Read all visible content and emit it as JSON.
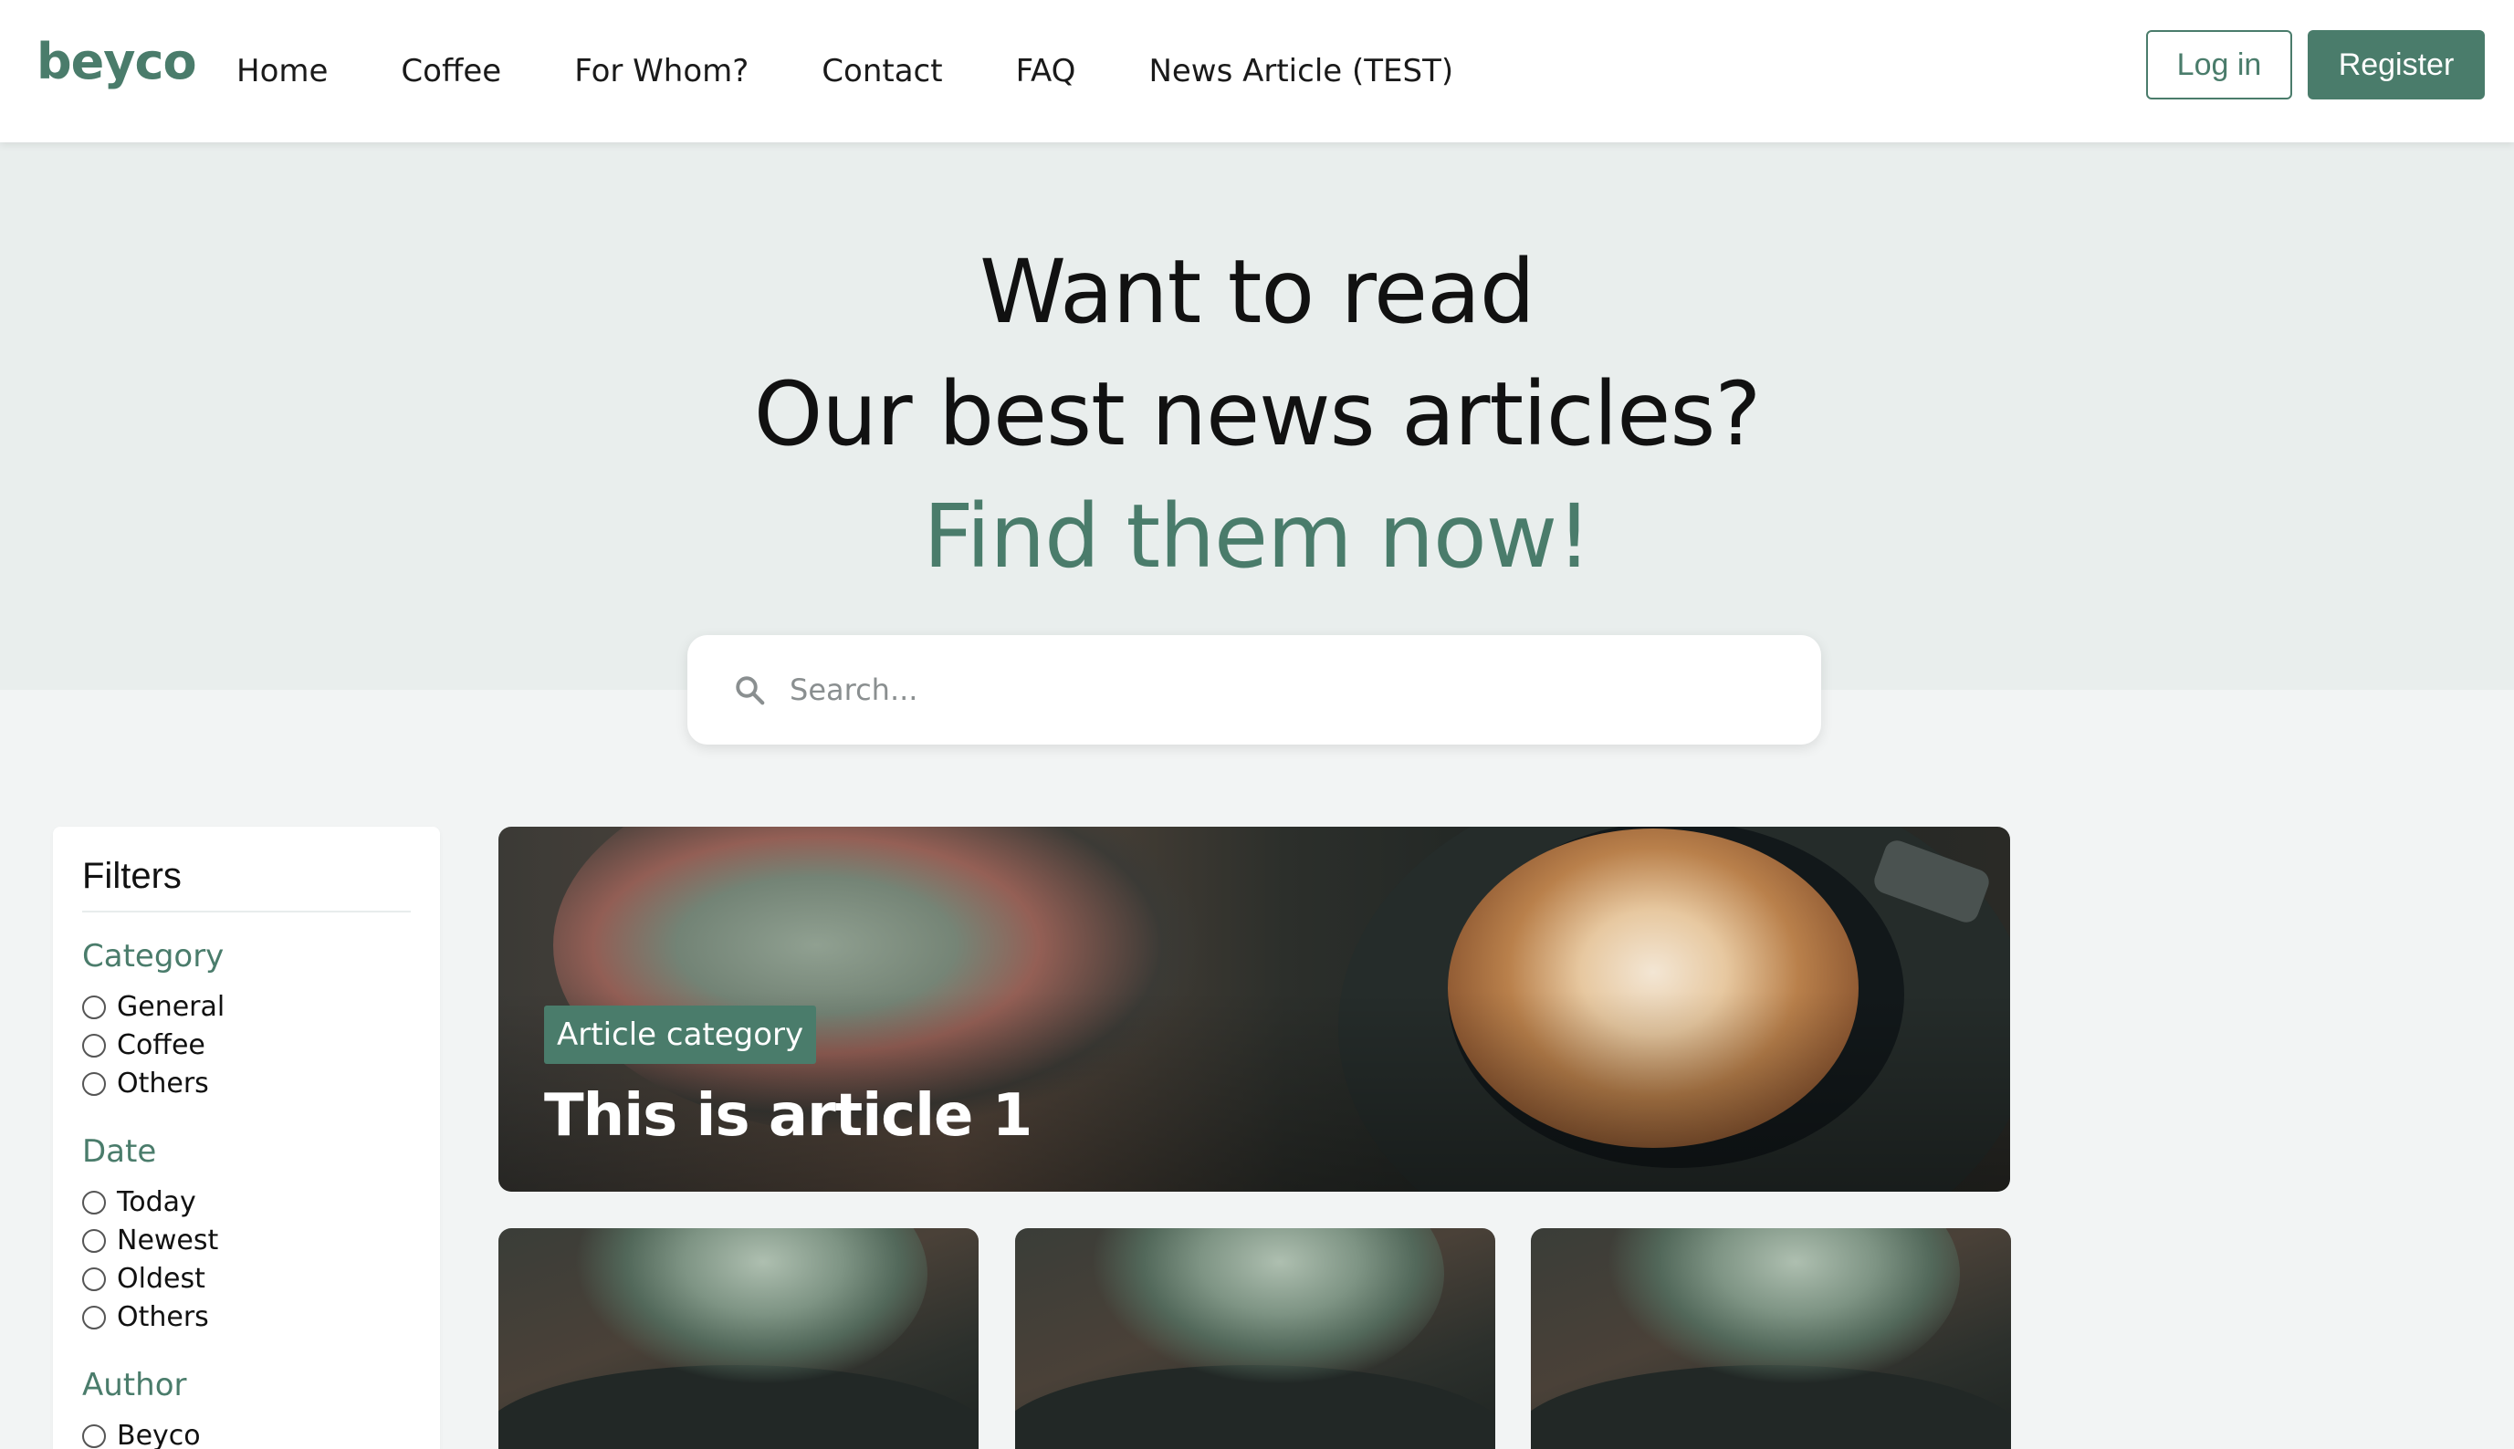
{
  "brand": {
    "logo_text": "beyco",
    "accent_color": "#4a7c6b"
  },
  "nav": {
    "links": [
      "Home",
      "Coffee",
      "For Whom?",
      "Contact",
      "FAQ",
      "News Article (TEST)"
    ],
    "login_label": "Log in",
    "register_label": "Register"
  },
  "hero": {
    "line1": "Want to read",
    "line2": "Our best news articles?",
    "line3": "Find them now!"
  },
  "search": {
    "placeholder": "Search..."
  },
  "filters": {
    "title": "Filters",
    "groups": [
      {
        "title": "Category",
        "options": [
          "General",
          "Coffee",
          "Others"
        ]
      },
      {
        "title": "Date",
        "options": [
          "Today",
          "Newest",
          "Oldest",
          "Others"
        ]
      },
      {
        "title": "Author",
        "options": [
          "Beyco"
        ]
      }
    ]
  },
  "featured": {
    "badge": "Article category",
    "title": "This is article 1"
  }
}
